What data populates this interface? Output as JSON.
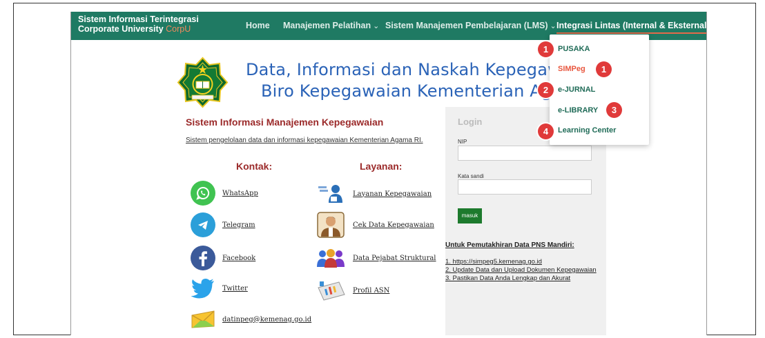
{
  "navbar": {
    "brand_line1": "Sistem Informasi Terintegrasi",
    "brand_line2": "Corporate University",
    "brand_accent": "CorpU",
    "items": [
      {
        "label": "Home"
      },
      {
        "label": "Manajemen Pelatihan",
        "chevron": "⌄"
      },
      {
        "label": "Sistem Manajemen Pembelajaran (LMS)",
        "chevron": "⌄"
      },
      {
        "label": "Integrasi Lintas (Internal & Eksternal)",
        "chevron": "⌄"
      }
    ]
  },
  "dropdown": {
    "items": [
      "PUSAKA",
      "SIMPeg",
      "e-JURNAL",
      "e-LIBRARY",
      "Learning Center"
    ]
  },
  "badges": [
    "1",
    "1",
    "2",
    "3",
    "4"
  ],
  "header": {
    "line1": "Data, Informasi dan Naskah Kepegawaian",
    "line2": "Biro Kepegawaian Kementerian Agama"
  },
  "main": {
    "title": "Sistem Informasi Manajemen Kepegawaian",
    "subtitle": "Sistem pengelolaan data dan informasi kepegawaian Kementerian Agama RI.",
    "contact_heading": "Kontak:",
    "service_heading": "Layanan:",
    "contacts": [
      "WhatsApp",
      "Telegram",
      "Facebook",
      "Twitter",
      "datinpeg@kemenag.go.id"
    ],
    "services": [
      "Layanan Kepegawaian",
      "Cek Data Kepegawaian",
      "Data Pejabat Struktural",
      "Profil ASN"
    ]
  },
  "login": {
    "title": "Login",
    "nip_label": "NIP",
    "password_label": "Kata sandi",
    "button": "masuk"
  },
  "update": {
    "title": "Untuk Pemutakhiran Data PNS Mandiri:",
    "lines": [
      "1. https://simpeg5.kemenag.go.id",
      "2. Update Data dan Upload Dokumen Kepegawaian",
      "3. Pastikan Data Anda Lengkap dan Akurat"
    ]
  },
  "colors": {
    "navbar": "#1f7a63",
    "badge": "#e03a3a",
    "headline": "#2b63b7",
    "section_title": "#9b2a2a",
    "login_button": "#1d7a2d"
  }
}
